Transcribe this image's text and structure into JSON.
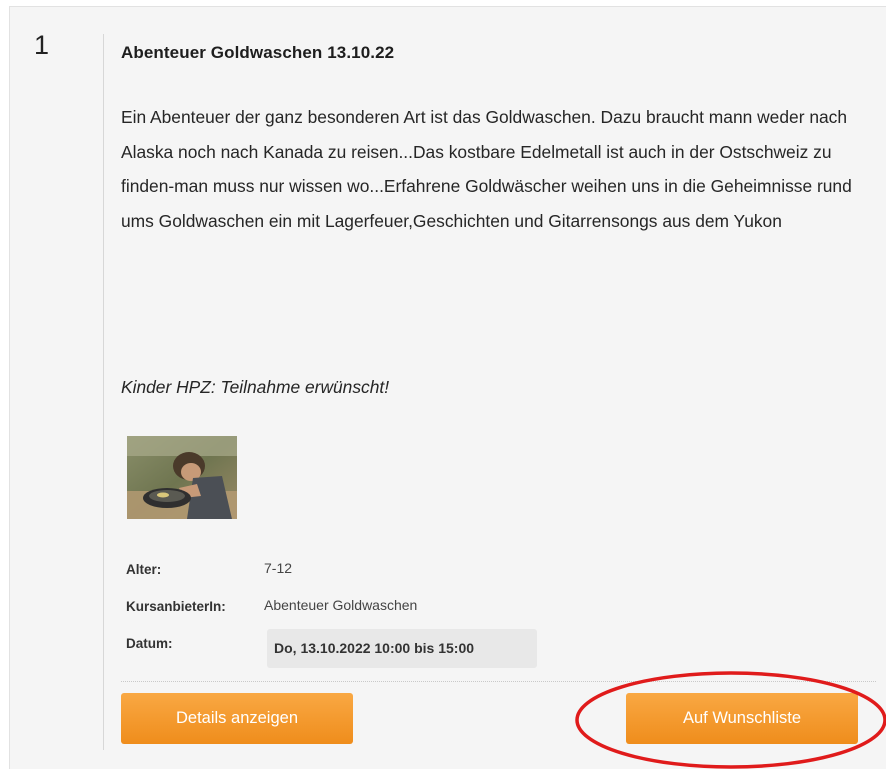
{
  "course": {
    "index": "1",
    "title": "Abenteuer Goldwaschen 13.10.22",
    "description": "Ein Abenteuer der ganz besonderen Art ist das Goldwaschen. Dazu braucht mann weder nach Alaska noch nach Kanada zu reisen...Das kostbare Edelmetall ist auch in der Ostschweiz zu finden-man muss nur wissen wo...Erfahrene Goldwäscher weihen uns in die Geheimnisse rund ums Goldwaschen ein mit Lagerfeuer,Geschichten und Gitarrensongs aus dem Yukon",
    "note": "Kinder HPZ: Teilnahme erwünscht!",
    "meta": {
      "age_label": "Alter:",
      "age_value": "7-12",
      "provider_label": "KursanbieterIn:",
      "provider_value": "Abenteuer Goldwaschen",
      "date_label": "Datum:",
      "date_value": "Do, 13.10.2022 10:00 bis 15:00"
    },
    "actions": {
      "details_label": "Details anzeigen",
      "wishlist_label": "Auf Wunschliste"
    }
  },
  "colors": {
    "button_top": "#f9a843",
    "button_bottom": "#ef8d1c",
    "highlight": "#e01b1b",
    "card_background": "#f5f5f5"
  }
}
